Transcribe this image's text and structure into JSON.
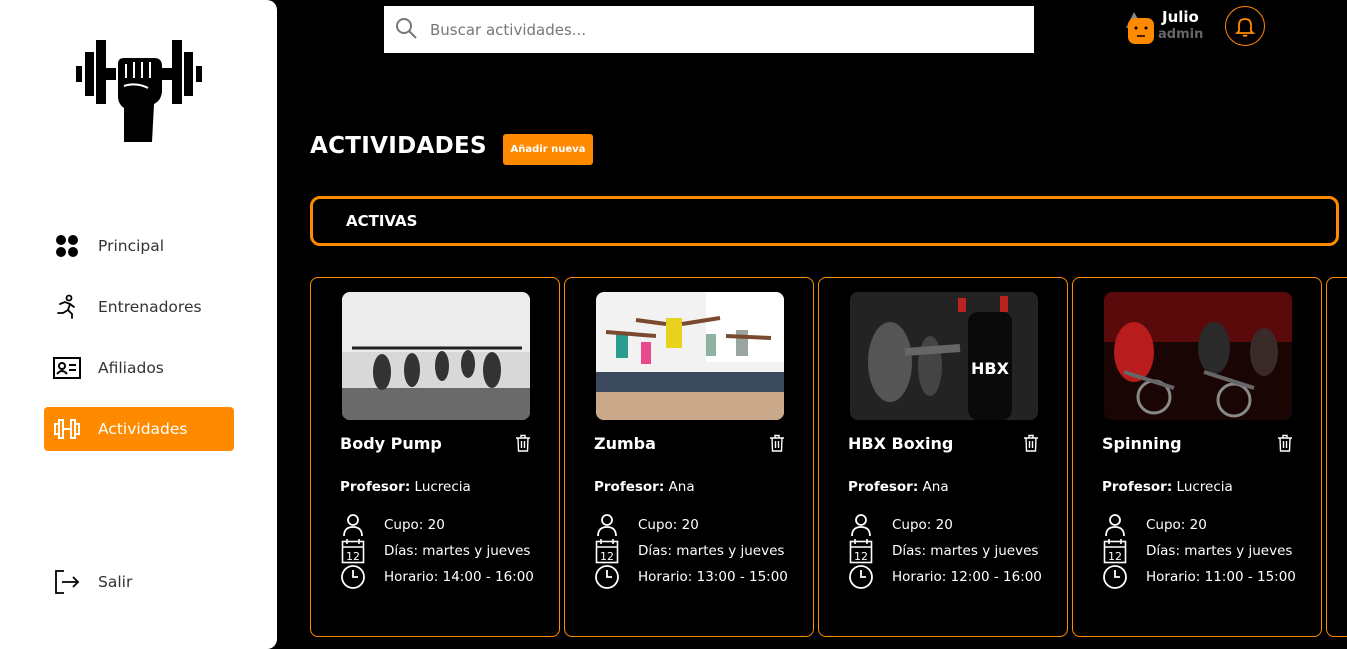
{
  "sidebar": {
    "items": [
      {
        "label": "Principal"
      },
      {
        "label": "Entrenadores"
      },
      {
        "label": "Afiliados"
      },
      {
        "label": "Actividades"
      },
      {
        "label": "Salir"
      }
    ]
  },
  "search": {
    "placeholder": "Buscar actividades...",
    "value": ""
  },
  "user": {
    "name": "Julio",
    "role": "admin"
  },
  "page": {
    "title": "ACTIVIDADES",
    "add_label": "Añadir nueva",
    "tab_label": "ACTIVAS"
  },
  "cards": [
    {
      "title": "Body Pump",
      "prof_label": "Profesor:",
      "prof": "Lucrecia",
      "cupo": "Cupo: 20",
      "dias": "Días: martes y jueves",
      "horario": "Horario: 14:00 - 16:00"
    },
    {
      "title": "Zumba",
      "prof_label": "Profesor:",
      "prof": "Ana",
      "cupo": "Cupo: 20",
      "dias": "Días: martes y jueves",
      "horario": "Horario: 13:00 - 15:00"
    },
    {
      "title": "HBX Boxing",
      "prof_label": "Profesor:",
      "prof": "Ana",
      "cupo": "Cupo: 20",
      "dias": "Días: martes y jueves",
      "horario": "Horario: 12:00 - 16:00"
    },
    {
      "title": "Spinning",
      "prof_label": "Profesor:",
      "prof": "Lucrecia",
      "cupo": "Cupo: 20",
      "dias": "Días: martes y jueves",
      "horario": "Horario: 11:00 - 15:00"
    }
  ],
  "colors": {
    "accent": "#ff8a00",
    "background": "#000000",
    "sidebar": "#ffffff"
  }
}
